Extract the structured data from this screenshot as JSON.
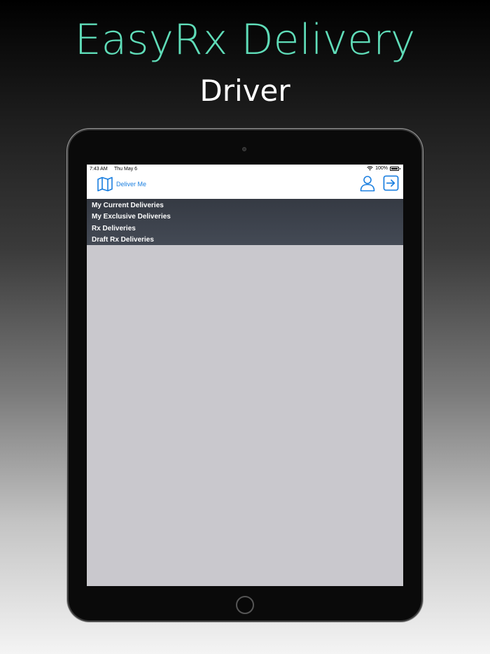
{
  "hero": {
    "title": "EasyRx Delivery",
    "subtitle": "Driver"
  },
  "status_bar": {
    "time": "7:43 AM",
    "date": "Thu May 6",
    "battery": "100%"
  },
  "nav": {
    "deliver_me_label": "Deliver Me",
    "accent_color": "#1a7fe0"
  },
  "menu": {
    "items": [
      {
        "label": "My Current Deliveries"
      },
      {
        "label": "My Exclusive Deliveries"
      },
      {
        "label": "Rx Deliveries"
      },
      {
        "label": "Draft Rx Deliveries"
      }
    ]
  },
  "icons": [
    "map-icon",
    "user-icon",
    "logout-icon",
    "wifi-icon",
    "battery-icon"
  ]
}
